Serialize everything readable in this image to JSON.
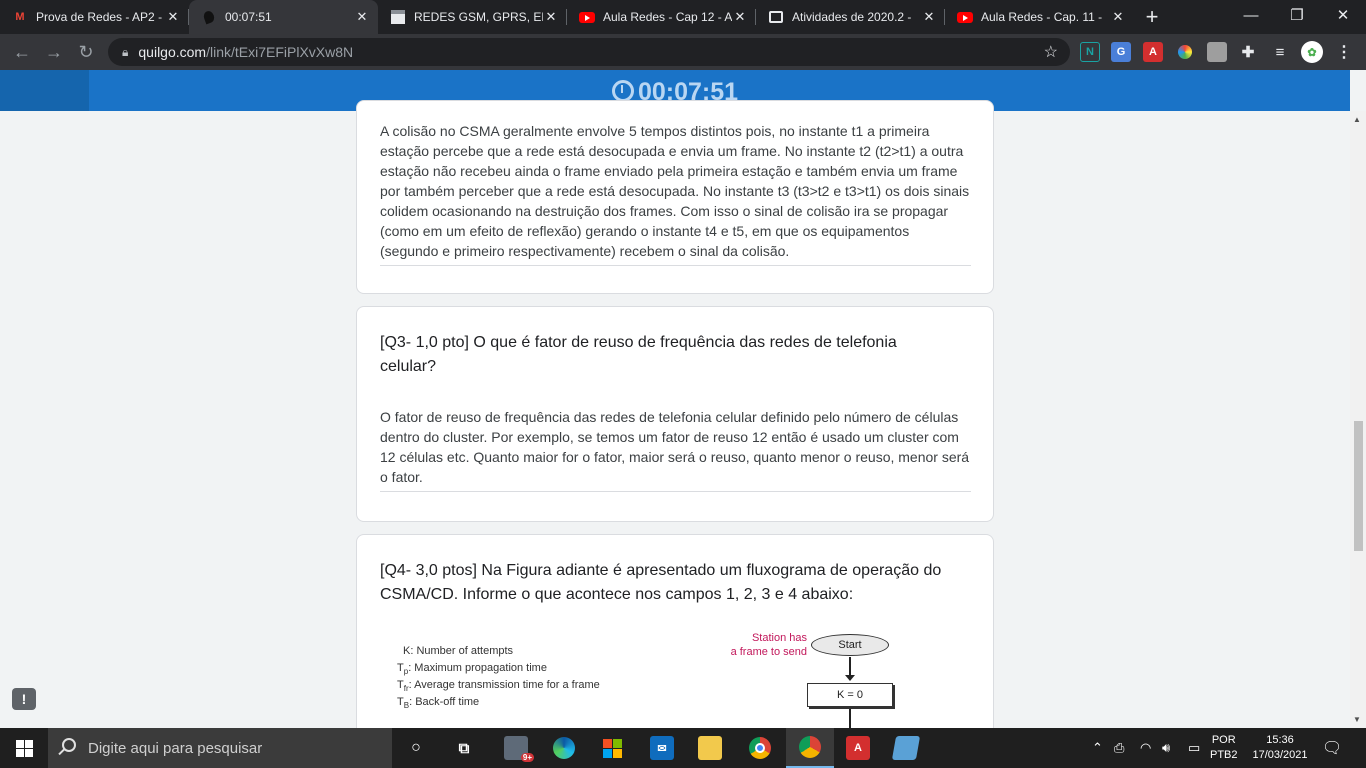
{
  "tabs": [
    {
      "title": "Prova de Redes - AP2 -",
      "icon": "gmail-icon",
      "active": false
    },
    {
      "title": "00:07:51",
      "icon": "quilgo-icon",
      "active": true
    },
    {
      "title": "REDES GSM, GPRS, EDG",
      "icon": "page-icon",
      "active": false
    },
    {
      "title": "Aula Redes - Cap 12 - A",
      "icon": "youtube-icon",
      "active": false
    },
    {
      "title": "Atividades de 2020.2 -",
      "icon": "classroom-icon",
      "active": false
    },
    {
      "title": "Aula Redes - Cap. 11 -",
      "icon": "youtube-icon",
      "active": false
    }
  ],
  "address": {
    "host": "quilgo.com",
    "path": "/link/tExi7EFiPlXvXw8N"
  },
  "timer": "00:07:51",
  "q2_answer": "A colisão no CSMA geralmente envolve 5 tempos distintos pois, no instante t1 a primeira estação percebe que a rede está desocupada e envia um frame. No instante t2 (t2>t1) a outra estação não recebeu ainda o frame enviado pela primeira estação e também envia um frame por também perceber que a rede está desocupada. No instante t3 (t3>t2 e t3>t1) os dois sinais colidem ocasionando na destruição dos frames. Com isso o sinal de colisão ira se propagar (como em um efeito de reflexão) gerando o instante t4 e t5, em que os equipamentos (segundo e primeiro respectivamente) recebem o sinal da colisão.",
  "q3": {
    "question": "[Q3- 1,0 pto] O que é fator de reuso de frequência das redes de telefonia celular?",
    "answer": "O fator de reuso de frequência das redes de telefonia celular definido pelo número de células dentro do cluster. Por exemplo, se temos um fator de reuso 12 então é usado um cluster com 12 células etc. Quanto maior for o fator, maior será o reuso, quanto menor o reuso, menor será o fator."
  },
  "q4": {
    "question": "[Q4- 3,0 ptos] Na Figura adiante é apresentado um fluxograma de operação do CSMA/CD. Informe o que acontece nos campos 1, 2, 3 e 4 abaixo:",
    "figure": {
      "legend_k": "K: Number of attempts",
      "legend_tp": "T",
      "legend_tp_sub": "p",
      "legend_tp_text": ": Maximum propagation time",
      "legend_tfr": "T",
      "legend_tfr_sub": "fr",
      "legend_tfr_text": ": Average transmission time for a frame",
      "legend_tb": "T",
      "legend_tb_sub": "B",
      "legend_tb_text": ": Back-off time",
      "station_line1": "Station has",
      "station_line2": "a frame to send",
      "start": "Start",
      "k0": "K = 0"
    }
  },
  "taskbar": {
    "search_placeholder": "Digite aqui para pesquisar",
    "lang_top": "POR",
    "lang_bottom": "PTB2",
    "time": "15:36",
    "date": "17/03/2021",
    "badge": "9+"
  },
  "colors": {
    "accent": "#1a73c7",
    "figure_magenta": "#c2185b"
  }
}
